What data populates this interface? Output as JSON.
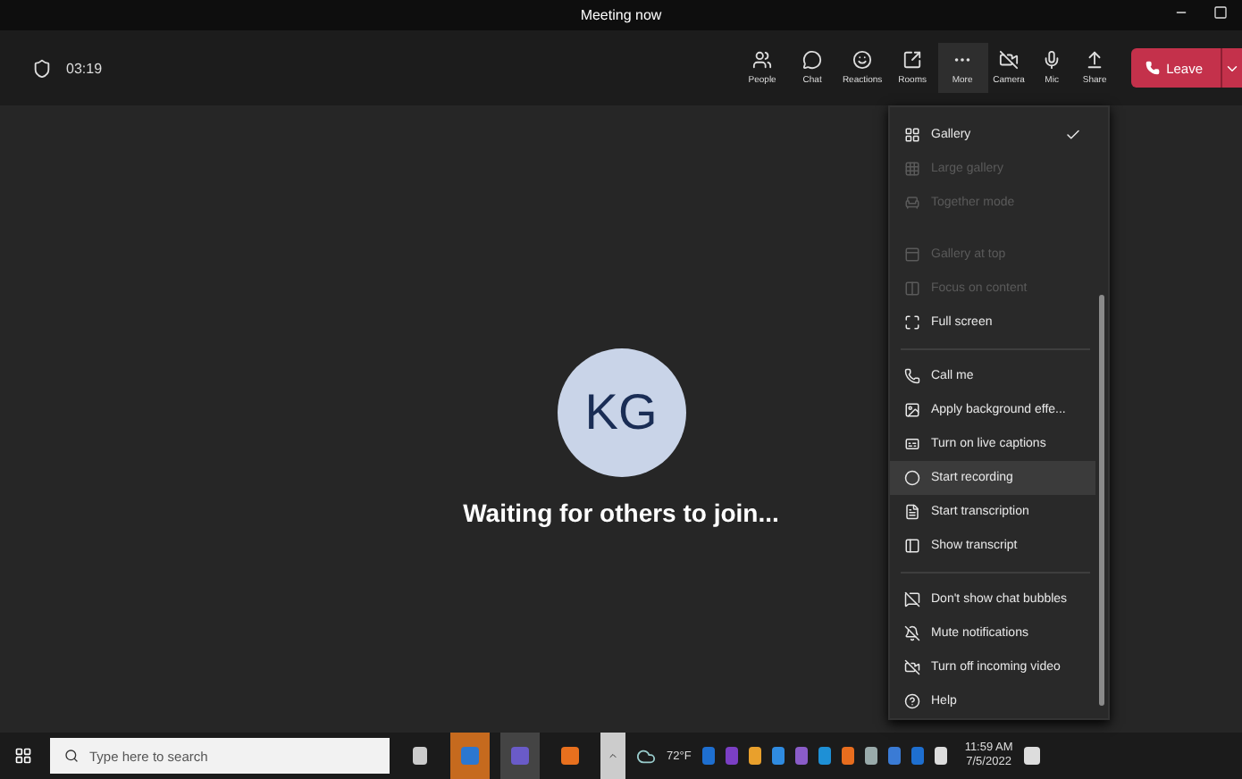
{
  "window": {
    "title": "Meeting now"
  },
  "meeting": {
    "timer": "03:19"
  },
  "toolbar": [
    {
      "label": "People"
    },
    {
      "label": "Chat"
    },
    {
      "label": "Reactions"
    },
    {
      "label": "Rooms"
    },
    {
      "label": "More",
      "selected": true
    },
    {
      "label": "Camera"
    },
    {
      "label": "Mic"
    },
    {
      "label": "Share"
    }
  ],
  "leave_button": {
    "label": "Leave"
  },
  "stage": {
    "avatar_initials": "KG",
    "status": "Waiting for others to join..."
  },
  "more_menu": [
    {
      "kind": "item",
      "label": "Gallery",
      "checked": true,
      "disabled": false,
      "hovered": false
    },
    {
      "kind": "item",
      "label": "Large gallery",
      "checked": false,
      "disabled": true,
      "hovered": false
    },
    {
      "kind": "item",
      "label": "Together mode",
      "checked": false,
      "disabled": true,
      "hovered": false
    },
    {
      "kind": "gap"
    },
    {
      "kind": "item",
      "label": "Gallery at top",
      "checked": false,
      "disabled": true,
      "hovered": false
    },
    {
      "kind": "item",
      "label": "Focus on content",
      "checked": false,
      "disabled": true,
      "hovered": false
    },
    {
      "kind": "item",
      "label": "Full screen",
      "checked": false,
      "disabled": false,
      "hovered": false
    },
    {
      "kind": "separator"
    },
    {
      "kind": "item",
      "label": "Call me",
      "checked": false,
      "disabled": false,
      "hovered": false
    },
    {
      "kind": "item",
      "label": "Apply background effe...",
      "checked": false,
      "disabled": false,
      "hovered": false
    },
    {
      "kind": "item",
      "label": "Turn on live captions",
      "checked": false,
      "disabled": false,
      "hovered": false
    },
    {
      "kind": "item",
      "label": "Start recording",
      "checked": false,
      "disabled": false,
      "hovered": true
    },
    {
      "kind": "item",
      "label": "Start transcription",
      "checked": false,
      "disabled": false,
      "hovered": false
    },
    {
      "kind": "item",
      "label": "Show transcript",
      "checked": false,
      "disabled": false,
      "hovered": false
    },
    {
      "kind": "separator"
    },
    {
      "kind": "item",
      "label": "Don't show chat bubbles",
      "checked": false,
      "disabled": false,
      "hovered": false
    },
    {
      "kind": "item",
      "label": "Mute notifications",
      "checked": false,
      "disabled": false,
      "hovered": false
    },
    {
      "kind": "item",
      "label": "Turn off incoming video",
      "checked": false,
      "disabled": false,
      "hovered": false
    },
    {
      "kind": "item",
      "label": "Help",
      "checked": false,
      "disabled": false,
      "hovered": false
    }
  ],
  "taskbar": {
    "search_placeholder": "Type here to search",
    "weather": "72°F",
    "time": "11:59 AM",
    "date": "7/5/2022"
  }
}
